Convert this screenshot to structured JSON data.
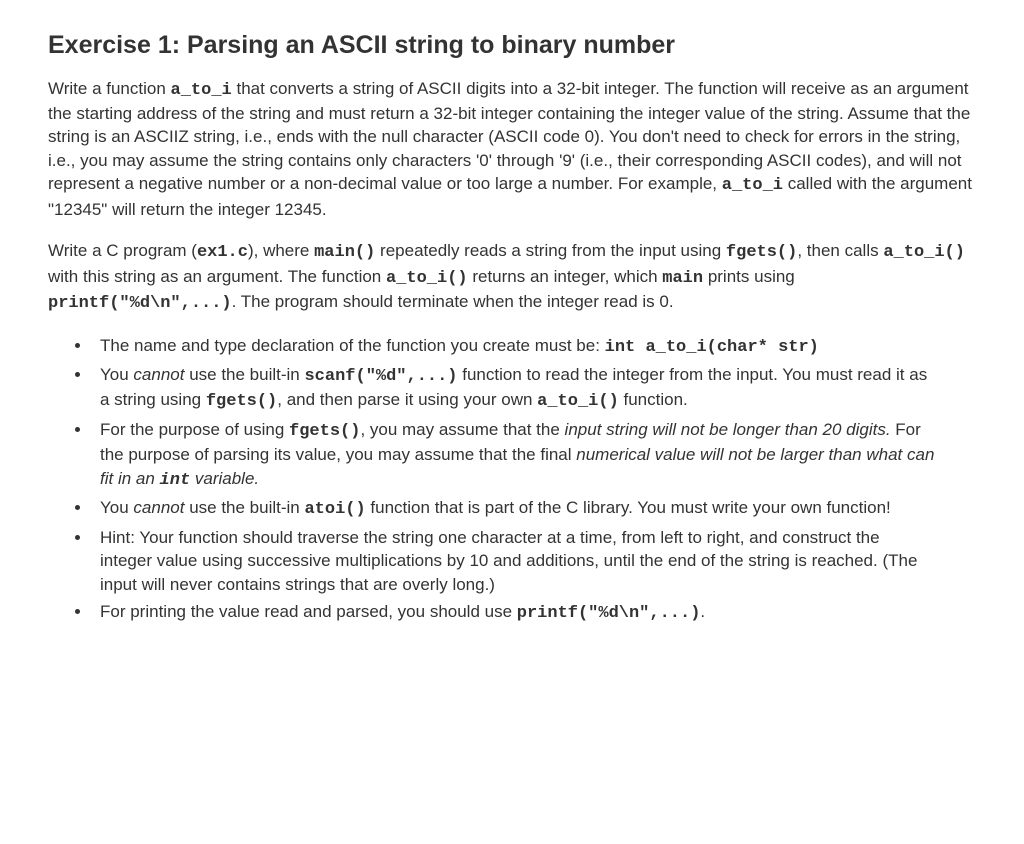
{
  "title": "Exercise 1: Parsing an ASCII string to binary number",
  "p1": {
    "t1": "Write a function ",
    "c1": "a_to_i",
    "t2": " that converts a string of ASCII digits into a 32-bit integer. The function will receive as an argument the starting address of the string and must return a 32-bit integer containing the integer value of the string. Assume that the string is an ASCIIZ string, i.e., ends with the null character (ASCII code 0). You don't need to check for errors in the string, i.e., you may assume the string contains only characters '0' through '9' (i.e., their corresponding ASCII codes), and will not represent a negative number or a non-decimal value or too large a number. For example, ",
    "c2": "a_to_i",
    "t3": " called with the argument \"12345\" will return the integer 12345."
  },
  "p2": {
    "t1": "Write a C program (",
    "c1": "ex1.c",
    "t2": "), where ",
    "c2": "main()",
    "t3": " repeatedly reads a string from the input using ",
    "c3": "fgets()",
    "t4": ", then calls ",
    "c4": "a_to_i()",
    "t5": " with this string as an argument. The function ",
    "c5": "a_to_i()",
    "t6": " returns an integer, which ",
    "c6": "main",
    "t7": " prints using ",
    "c7": "printf(\"%d\\n\",...)",
    "t8": ". The program should terminate when the integer read is 0."
  },
  "b1": {
    "t1": "The name and type declaration of the function you create must be: ",
    "c1": "int a_to_i(char* str)"
  },
  "b2": {
    "t1": "You ",
    "e1": "cannot",
    "t2": " use the built-in ",
    "c1": "scanf(\"%d\",...)",
    "t3": " function to read the integer from the input. You must read it as a string using ",
    "c2": "fgets()",
    "t4": ", and then parse it using your own ",
    "c3": "a_to_i()",
    "t5": " function."
  },
  "b3": {
    "t1": "For the purpose of using ",
    "c1": "fgets()",
    "t2": ", you may assume that the ",
    "e1": "input string will not be longer than 20 digits.",
    "t3": " For the purpose of parsing its value, you may assume that the final ",
    "e2": "numerical value will not be larger than what can fit in an ",
    "c2": "int",
    "e3": " variable."
  },
  "b4": {
    "t1": "You ",
    "e1": "cannot",
    "t2": " use the built-in ",
    "c1": "atoi()",
    "t3": " function that is part of the C library. You must write your own function!"
  },
  "b5": {
    "t1": "Hint: Your function should traverse the string one character at a time, from left to right, and construct the integer value using successive multiplications by 10 and additions, until the end of the string is reached. (The input will never contains strings that are overly long.)"
  },
  "b6": {
    "t1": "For printing the value read and parsed, you should use ",
    "c1": "printf(\"%d\\n\",...)",
    "t2": "."
  }
}
